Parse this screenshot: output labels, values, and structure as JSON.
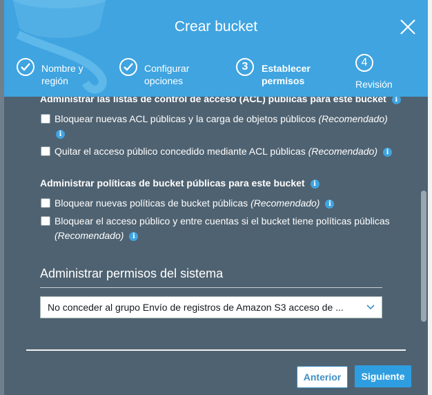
{
  "modal": {
    "title": "Crear bucket",
    "steps": [
      {
        "number": "",
        "label_line1": "Nombre y",
        "label_line2": "región",
        "state": "completed"
      },
      {
        "number": "",
        "label_line1": "Configurar",
        "label_line2": "opciones",
        "state": "completed"
      },
      {
        "number": "3",
        "label_line1": "Establecer",
        "label_line2": "permisos",
        "state": "current"
      },
      {
        "number": "4",
        "label_line1": "",
        "label_line2": "Revisión",
        "state": "pending"
      }
    ]
  },
  "acl_section": {
    "title": "Administrar las listas de control de acceso (ACL) públicas para este bucket",
    "options": [
      {
        "text": "Bloquear nuevas ACL públicas y la carga de objetos públicos",
        "recommended": "(Recomendado)",
        "checked": false
      },
      {
        "text": "Quitar el acceso público concedido mediante ACL públicas",
        "recommended": "(Recomendado)",
        "checked": false
      }
    ]
  },
  "policy_section": {
    "title": "Administrar políticas de bucket públicas para este bucket",
    "options": [
      {
        "text": "Bloquear nuevas políticas de bucket públicas",
        "recommended": "(Recomendado)",
        "checked": false
      },
      {
        "text": "Bloquear el acceso público y entre cuentas si el bucket tiene políticas públicas",
        "recommended": "(Recomendado)",
        "checked": false
      }
    ]
  },
  "system_permissions": {
    "title": "Administrar permisos del sistema",
    "select_value": "No conceder al grupo Envío de registros de Amazon S3 acceso de ..."
  },
  "footer": {
    "previous_label": "Anterior",
    "next_label": "Siguiente"
  },
  "colors": {
    "header": "#3fa4e0",
    "body": "#4f6271",
    "accent": "#2e9ee0"
  },
  "info_glyph": "i"
}
